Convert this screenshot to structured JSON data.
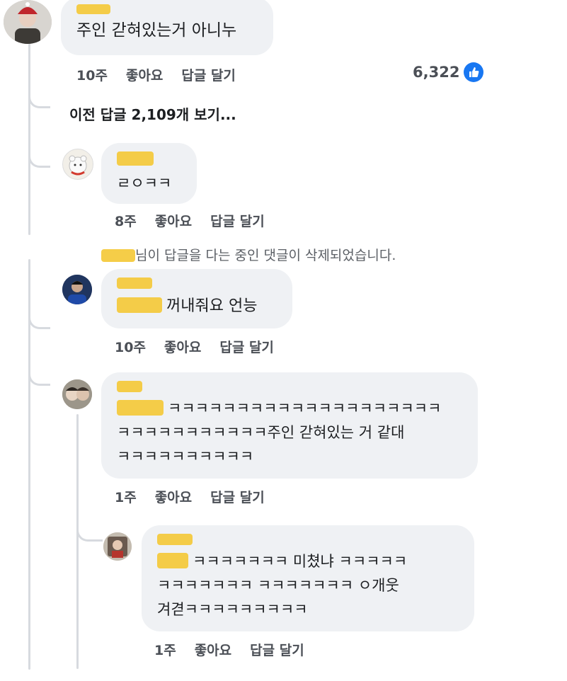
{
  "comments": [
    {
      "text": "주인 갇혀있는거 아니누",
      "time": "10주",
      "like": "좋아요",
      "reply": "답글 달기",
      "like_count": "6,322"
    },
    {
      "text": "ㄹㅇㅋㅋ",
      "time": "8주",
      "like": "좋아요",
      "reply": "답글 달기"
    },
    {
      "text": "꺼내줘요 언능",
      "time": "10주",
      "like": "좋아요",
      "reply": "답글 달기"
    },
    {
      "line1": "ㅋㅋㅋㅋㅋㅋㅋㅋㅋㅋㅋㅋㅋㅋㅋㅋㅋㅋㅋㅋ",
      "line2": "ㅋㅋㅋㅋㅋㅋㅋㅋㅋㅋㅋ주인 갇혀있는 거 같대",
      "line3": "ㅋㅋㅋㅋㅋㅋㅋㅋㅋㅋ",
      "time": "1주",
      "like": "좋아요",
      "reply": "답글 달기"
    },
    {
      "line1": "ㅋㅋㅋㅋㅋㅋㅋ 미쳤냐 ㅋㅋㅋㅋㅋ",
      "line2": "ㅋㅋㅋㅋㅋㅋㅋ ㅋㅋㅋㅋㅋㅋㅋ ㅇ개웃",
      "line3": "겨겯ㅋㅋㅋㅋㅋㅋㅋㅋㅋ",
      "time": "1주",
      "like": "좋아요",
      "reply": "답글 달기"
    }
  ],
  "previous_replies": {
    "before": "이전 답글 ",
    "count": "2,109",
    "after": "개 보기..."
  },
  "deleted_notice": "님이 답글을 다는 중인 댓글이 삭제되었습니다.",
  "icons": {
    "like": "thumbs-up-icon"
  },
  "colors": {
    "bubble": "#eff1f4",
    "mask": "#f4c938",
    "like_blue": "#1877f2"
  }
}
